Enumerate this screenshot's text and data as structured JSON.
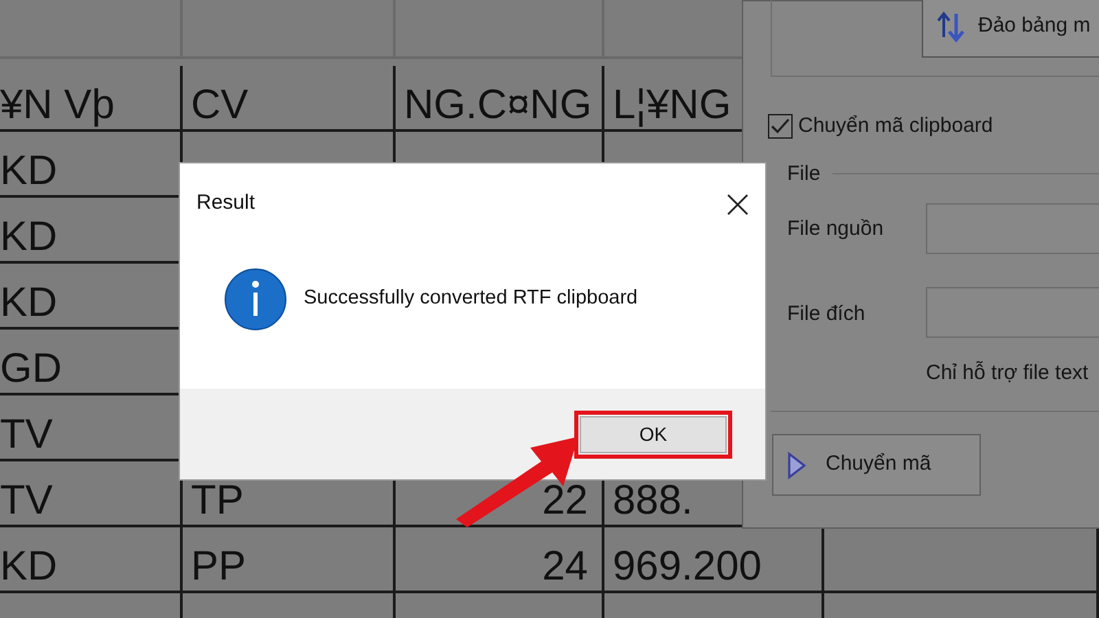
{
  "spreadsheet": {
    "header": [
      "¥N Vþ",
      "CV",
      "NG.C¤NG",
      "L¦¥NG"
    ],
    "rows": [
      [
        "KD"
      ],
      [
        "KD"
      ],
      [
        "KD"
      ],
      [
        "GD"
      ],
      [
        "TV"
      ],
      [
        "TV",
        "TP",
        "22",
        "888."
      ],
      [
        "KD",
        "PP",
        "24",
        "969.200"
      ],
      []
    ]
  },
  "tool_panel": {
    "swap_button": "Đảo bảng m",
    "clipboard_checkbox": {
      "label": "Chuyển mã clipboard",
      "checked": true
    },
    "file_group": {
      "title": "File",
      "fields": [
        {
          "label": "File nguồn"
        },
        {
          "label": "File đích"
        }
      ],
      "note": "Chỉ hỗ trợ file text"
    },
    "convert_button": "Chuyển mã"
  },
  "dialog": {
    "title": "Result",
    "message": "Successfully converted RTF clipboard",
    "buttons": [
      {
        "label": "OK",
        "highlighted": true
      }
    ]
  }
}
